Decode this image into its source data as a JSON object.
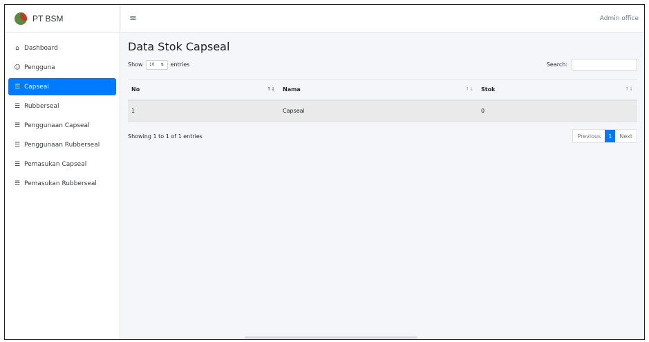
{
  "brand": {
    "name": "PT BSM"
  },
  "sidebar": {
    "items": [
      {
        "label": "Dashboard",
        "icon": "home-icon"
      },
      {
        "label": "Pengguna",
        "icon": "users-icon"
      },
      {
        "label": "Capseal",
        "icon": "list-icon",
        "active": true
      },
      {
        "label": "Rubberseal",
        "icon": "list-icon"
      },
      {
        "label": "Penggunaan Capseal",
        "icon": "list-icon"
      },
      {
        "label": "Penggunaan Rubberseal",
        "icon": "list-icon"
      },
      {
        "label": "Pemasukan Capseal",
        "icon": "list-icon"
      },
      {
        "label": "Pemasukan Rubberseal",
        "icon": "list-icon"
      }
    ]
  },
  "topbar": {
    "user": "Admin office"
  },
  "main": {
    "title": "Data Stok Capseal",
    "length": {
      "show": "Show",
      "value": "10",
      "entries": "entries"
    },
    "search_label": "Search:",
    "table": {
      "columns": [
        "No",
        "Nama",
        "Stok"
      ],
      "rows": [
        [
          "1",
          "Capseal",
          "0"
        ]
      ]
    },
    "info": "Showing 1 to 1 of 1 entries",
    "pagination": {
      "previous": "Previous",
      "current": "1",
      "next": "Next"
    }
  },
  "colors": {
    "accent": "#007bff",
    "background": "#f4f6f9"
  }
}
